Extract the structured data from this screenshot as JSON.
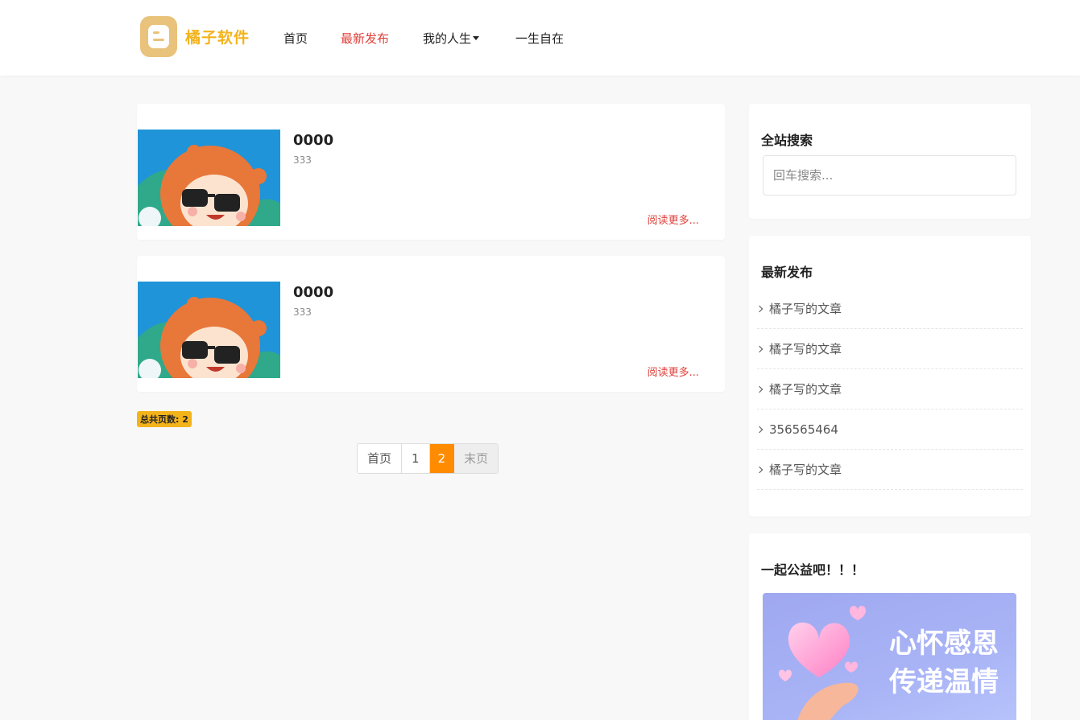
{
  "header": {
    "logo_text": "橘子软件",
    "nav": [
      {
        "label": "首页"
      },
      {
        "label": "最新发布"
      },
      {
        "label": "我的人生"
      },
      {
        "label": "一生自在"
      }
    ]
  },
  "posts": [
    {
      "title": "0000",
      "desc": "333",
      "read_more": "阅读更多..."
    },
    {
      "title": "0000",
      "desc": "333",
      "read_more": "阅读更多..."
    }
  ],
  "total_pages": "总共页数: 2",
  "pagination": {
    "first": "首页",
    "pages": [
      "1",
      "2"
    ],
    "last": "末页",
    "current": "2"
  },
  "sidebar": {
    "search": {
      "title": "全站搜索",
      "placeholder": "回车搜索..."
    },
    "latest": {
      "title": "最新发布",
      "items": [
        "橘子写的文章",
        "橘子写的文章",
        "橘子写的文章",
        "356565464",
        "橘子写的文章"
      ]
    },
    "charity": {
      "title": "一起公益吧！！！",
      "banner_text_line1": "心怀感恩",
      "banner_text_line2": "传递温情"
    }
  },
  "colors": {
    "brand": "#f3b31b",
    "accent_red": "#e0403a",
    "page_active": "#ff8c00"
  }
}
